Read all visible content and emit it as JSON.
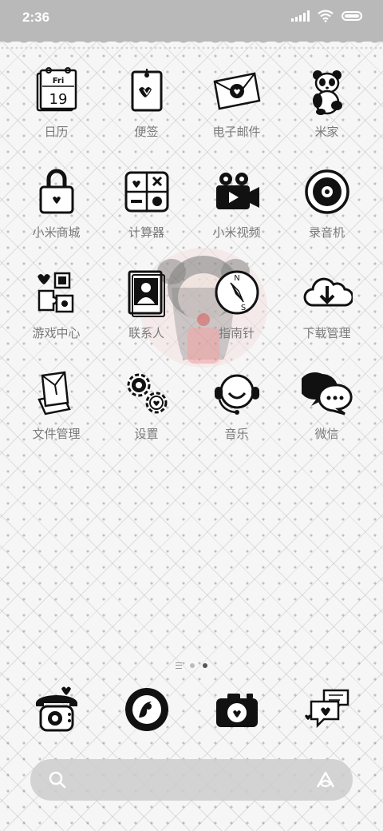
{
  "status_bar": {
    "time": "2:36"
  },
  "apps": [
    {
      "name": "calendar-app",
      "icon": "calendar-icon",
      "label": "日历",
      "icon_text": "Fri",
      "icon_day": "19"
    },
    {
      "name": "notes-app",
      "icon": "notes-icon",
      "label": "便签"
    },
    {
      "name": "email-app",
      "icon": "envelope-icon",
      "label": "电子邮件"
    },
    {
      "name": "mi-home-app",
      "icon": "panda-icon",
      "label": "米家"
    },
    {
      "name": "mi-store-app",
      "icon": "lock-icon",
      "label": "小米商城"
    },
    {
      "name": "calculator-app",
      "icon": "calculator-icon",
      "label": "计算器"
    },
    {
      "name": "mi-video-app",
      "icon": "video-camera-icon",
      "label": "小米视频"
    },
    {
      "name": "recorder-app",
      "icon": "record-icon",
      "label": "录音机"
    },
    {
      "name": "game-center-app",
      "icon": "puzzle-icon",
      "label": "游戏中心"
    },
    {
      "name": "contacts-app",
      "icon": "contacts-book-icon",
      "label": "联系人"
    },
    {
      "name": "compass-app",
      "icon": "compass-icon",
      "label": "指南针",
      "icon_n": "N",
      "icon_s": "S"
    },
    {
      "name": "downloads-app",
      "icon": "cloud-download-icon",
      "label": "下载管理"
    },
    {
      "name": "file-manager-app",
      "icon": "folder-icon",
      "label": "文件管理"
    },
    {
      "name": "settings-app",
      "icon": "gears-icon",
      "label": "设置"
    },
    {
      "name": "music-app",
      "icon": "headphones-icon",
      "label": "音乐"
    },
    {
      "name": "wechat-app",
      "icon": "chat-bubbles-icon",
      "label": "微信"
    }
  ],
  "dock": [
    {
      "name": "phone-app",
      "icon": "telephone-icon"
    },
    {
      "name": "browser-app",
      "icon": "browser-icon"
    },
    {
      "name": "camera-app",
      "icon": "camera-icon"
    },
    {
      "name": "messages-app",
      "icon": "message-bubbles-icon"
    }
  ],
  "page_indicator": {
    "pages": 2,
    "active": 2
  },
  "search": {
    "icon": "search-icon",
    "assistant_icon": "assistant-icon"
  }
}
